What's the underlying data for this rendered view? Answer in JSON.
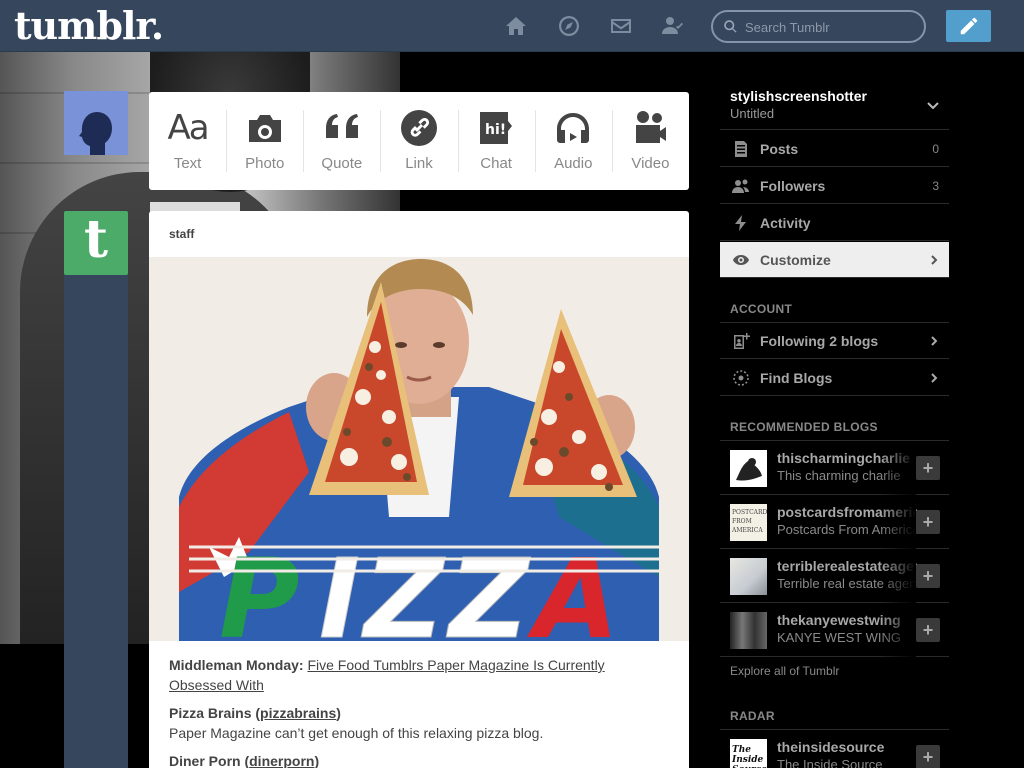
{
  "header": {
    "logo": "tumblr.",
    "nav": [
      {
        "name": "dashboard-home-icon",
        "icon": "home"
      },
      {
        "name": "explore-compass-icon",
        "icon": "compass"
      },
      {
        "name": "inbox-mail-icon",
        "icon": "mail"
      },
      {
        "name": "account-person-icon",
        "icon": "person-check"
      }
    ],
    "search_placeholder": "Search Tumblr",
    "compose_icon": "pencil-icon",
    "bg_color": "#36465d",
    "compose_color": "#529ecc"
  },
  "post_types": [
    {
      "label": "Text",
      "glyph": "Aa",
      "icon": "text-icon"
    },
    {
      "label": "Photo",
      "icon": "camera-icon"
    },
    {
      "label": "Quote",
      "icon": "quote-icon"
    },
    {
      "label": "Link",
      "icon": "link-icon"
    },
    {
      "label": "Chat",
      "glyph": "hi!",
      "icon": "chat-icon"
    },
    {
      "label": "Audio",
      "icon": "headphones-icon"
    },
    {
      "label": "Video",
      "icon": "video-camera-icon"
    }
  ],
  "post": {
    "author": "staff",
    "photo_caption_word": "PIZZA",
    "intro_bold": "Middleman Monday: ",
    "intro_link": "Five Food Tumblrs Paper Magazine Is Currently Obsessed With",
    "item1_name": "Pizza Brains (",
    "item1_link": "pizzabrains",
    "item1_close": ")",
    "item1_desc": "Paper Magazine can’t get enough of this relaxing pizza blog.",
    "item2_name": "Diner Porn (",
    "item2_link": "dinerporn",
    "item2_close": ")"
  },
  "sidebar": {
    "blog_name": "stylishscreenshotter",
    "blog_title": "Untitled",
    "rows": [
      {
        "label": "Posts",
        "count": "0",
        "icon": "posts-icon"
      },
      {
        "label": "Followers",
        "count": "3",
        "icon": "followers-icon"
      },
      {
        "label": "Activity",
        "icon": "activity-bolt-icon"
      },
      {
        "label": "Customize",
        "icon": "eye-icon",
        "active": true
      }
    ],
    "account_heading": "ACCOUNT",
    "account_rows": [
      {
        "label": "Following 2 blogs",
        "icon": "following-icon"
      },
      {
        "label": "Find Blogs",
        "icon": "find-blogs-icon"
      }
    ],
    "recommended_heading": "RECOMMENDED BLOGS",
    "recommended": [
      {
        "name": "thischarmingcharlie",
        "sub": "This charming charlie"
      },
      {
        "name": "postcardsfromamerica",
        "sub": "Postcards From America",
        "thumb_text": "POSTCARDS FROM AMERICA"
      },
      {
        "name": "terriblerealestateagentphotos",
        "sub": "Terrible real estate agent photos"
      },
      {
        "name": "thekanyewestwing",
        "sub": "KANYE WEST WING"
      }
    ],
    "explore_link": "Explore all of Tumblr",
    "radar_heading": "RADAR",
    "radar": {
      "name": "theinsidesource",
      "sub": "The Inside Source",
      "thumb_text": "The Inside Source"
    }
  }
}
